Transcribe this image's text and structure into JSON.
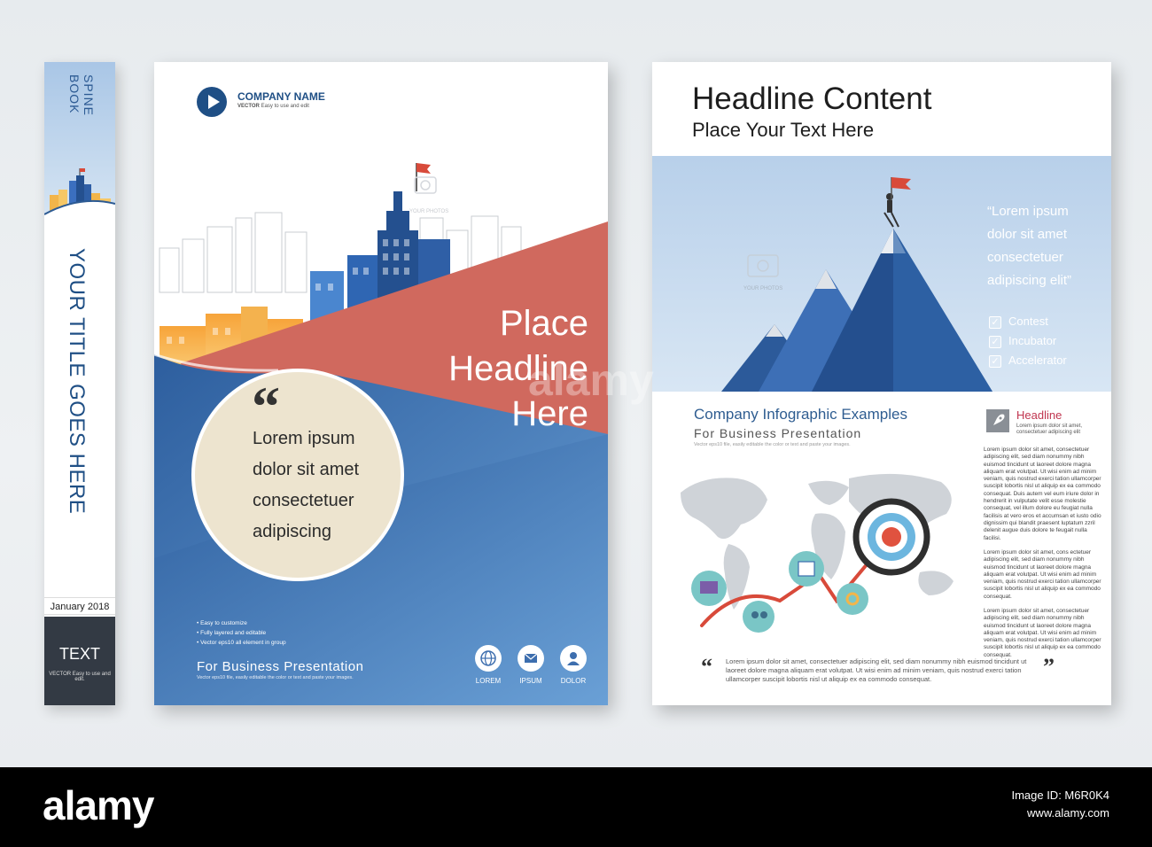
{
  "spine": {
    "spine_label": "SPINE",
    "book_label": "BOOK",
    "title": "YOUR TITLE GOES HERE",
    "date": "January 2018",
    "text": "TEXT",
    "vector_note": "VECTOR Easy to use and edit."
  },
  "cover": {
    "company_name": "COMPANY NAME",
    "company_tag_strong": "VECTOR",
    "company_tag": "Easy to use and edit",
    "your_photos": "YOUR PHOTOS",
    "headline_lines": [
      "Place",
      "Headline",
      "Here"
    ],
    "quote_mark": "“",
    "circle_lines": [
      "Lorem ipsum",
      "dolor sit amet",
      "consectetuer",
      "adipiscing"
    ],
    "bullets": [
      "Easy to customize",
      "Fully layered and editable",
      "Vector eps10 all element in group"
    ],
    "footer_title": "For Business Presentation",
    "footer_sub": "Vector eps10 file, easily editable the color or text and paste your images.",
    "icons": [
      {
        "name": "globe-icon",
        "label": "LOREM"
      },
      {
        "name": "envelope-icon",
        "label": "IPSUM"
      },
      {
        "name": "person-icon",
        "label": "DOLOR"
      }
    ]
  },
  "brochure": {
    "headline": "Headline Content",
    "subheadline": "Place Your Text Here",
    "your_photos": "YOUR PHOTOS",
    "quote_lines": [
      "“Lorem ipsum",
      "dolor sit amet",
      "consectetuer",
      "adipiscing elit”"
    ],
    "checklist": [
      "Contest",
      "Incubator",
      "Accelerator"
    ],
    "section_title": "Company Infographic Examples",
    "section_subtitle": "For Business Presentation",
    "section_note": "Vector eps10 file, easily editable the color or text and paste your images.",
    "side_headline": "Headline",
    "side_headline_sub": "Lorem ipsum dolor sit amet, consectetuer adipiscing elit",
    "side_para_1": "Lorem ipsum dolor sit amet, consectetuer adipiscing elit, sed diam nonummy nibh euismod tincidunt ut laoreet dolore magna aliquam erat volutpat. Ut wisi enim ad minim veniam, quis nostrud exerci tation ullamcorper suscipit lobortis nisl ut aliquip ex ea commodo consequat. Duis autem vel eum iriure dolor in hendrerit in vulputate velit esse molestie consequat, vel illum dolore eu feugiat nulla facilisis at vero eros et accumsan et iusto odio dignissim qui blandit praesent luptatum zzril delenit augue duis dolore te feugait nulla facilisi.",
    "side_para_2": "Lorem ipsum dolor sit amet, cons ectetuer adipiscing elit, sed diam nonummy nibh euismod tincidunt ut laoreet dolore magna aliquam erat volutpat. Ut wisi enim ad minim veniam, quis nostrud exerci tation ullamcorper suscipit lobortis nisl ut aliquip ex ea commodo consequat.",
    "side_para_3": "Lorem ipsum dolor sit amet, consectetuer adipiscing elit, sed diam nonummy nibh euismod tincidunt ut laoreet dolore magna aliquam erat volutpat. Ut wisi enim ad minim veniam, quis nostrud exerci tation ullamcorper suscipit lobortis nisl ut aliquip ex ea commodo consequat.",
    "bottom_quote": "Lorem ipsum dolor sit amet, consectetuer adipiscing elit, sed diam nonummy nibh euismod tincidunt ut laoreet dolore magna aliquam erat volutpat. Ut wisi enim ad minim veniam, quis nostrud exerci tation ullamcorper suscipit lobortis nisl ut aliquip ex ea commodo consequat.",
    "open_quote": "“",
    "close_quote": "”"
  },
  "watermark": {
    "overlay": "alamy",
    "brand": "alamy",
    "image_id": "Image ID: M6R0K4",
    "url": "www.alamy.com"
  },
  "colors": {
    "navy": "#1f4f85",
    "coral": "#d0695e",
    "blue": "#3d6eae",
    "cream": "#ede4cf",
    "sky": "#a9c6e6",
    "accent_red": "#d84a3a"
  }
}
